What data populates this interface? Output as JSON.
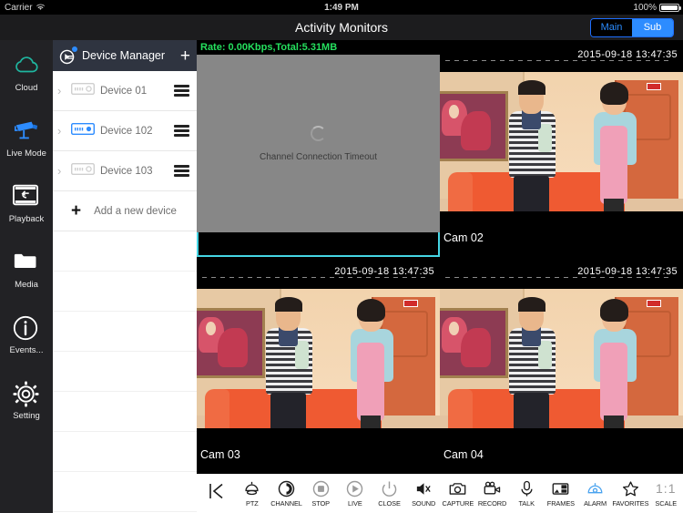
{
  "statusbar": {
    "carrier": "Carrier",
    "wifi_icon": "wifi-icon",
    "time": "1:49 PM",
    "battery": "100%"
  },
  "navbar": {
    "title": "Activity Monitors",
    "stream_toggle": {
      "options": [
        "Main",
        "Sub"
      ],
      "selected": "Sub"
    }
  },
  "rail": {
    "items": [
      {
        "label": "Cloud",
        "icon": "cloud-icon",
        "color": "#1fb6a0"
      },
      {
        "label": "Live Mode",
        "icon": "camera-icon",
        "color": "#2d8cff"
      },
      {
        "label": "Playback",
        "icon": "playback-icon",
        "color": "#ffffff"
      },
      {
        "label": "Media",
        "icon": "folder-icon",
        "color": "#ffffff"
      },
      {
        "label": "Events...",
        "icon": "info-icon",
        "color": "#ffffff"
      },
      {
        "label": "Setting",
        "icon": "gear-icon",
        "color": "#ffffff"
      }
    ]
  },
  "device_panel": {
    "header_title": "Device Manager",
    "header_icon": "dvr-badge-icon",
    "add_icon": "plus-icon",
    "devices": [
      {
        "name": "Device 01",
        "connected": false
      },
      {
        "name": "Device 102",
        "connected": true
      },
      {
        "name": "Device 103",
        "connected": false
      }
    ],
    "add_device_label": "Add a new device"
  },
  "grid": {
    "cells": [
      {
        "id": "cell-1",
        "selected": true,
        "state": "timeout",
        "rate_text": "Rate: 0.00Kbps,Total:5.31MB",
        "message": "Channel Connection Timeout",
        "timestamp": "",
        "label": ""
      },
      {
        "id": "cell-2",
        "selected": false,
        "state": "live",
        "rate_text": "",
        "message": "",
        "timestamp": "2015-09-18  13:47:35",
        "label": "Cam 02"
      },
      {
        "id": "cell-3",
        "selected": false,
        "state": "live",
        "rate_text": "",
        "message": "",
        "timestamp": "2015-09-18  13:47:35",
        "label": "Cam 03"
      },
      {
        "id": "cell-4",
        "selected": false,
        "state": "live",
        "rate_text": "",
        "message": "",
        "timestamp": "2015-09-18  13:47:35",
        "label": "Cam 04"
      }
    ],
    "selection_color": "#45d5e4",
    "rate_color": "#25e05e"
  },
  "toolbar": {
    "back_icon": "back-to-start-icon",
    "items": [
      {
        "label": "PTZ",
        "icon": "ptz-icon",
        "active": false
      },
      {
        "label": "CHANNEL",
        "icon": "channel-icon",
        "active": false
      },
      {
        "label": "STOP",
        "icon": "stop-icon",
        "active": false
      },
      {
        "label": "LIVE",
        "icon": "play-icon",
        "active": false
      },
      {
        "label": "CLOSE",
        "icon": "power-icon",
        "active": false
      },
      {
        "label": "SOUND",
        "icon": "speaker-icon",
        "active": false
      },
      {
        "label": "CAPTURE",
        "icon": "photo-camera-icon",
        "active": false
      },
      {
        "label": "RECORD",
        "icon": "video-camera-icon",
        "active": false
      },
      {
        "label": "TALK",
        "icon": "microphone-icon",
        "active": false
      },
      {
        "label": "FRAMES",
        "icon": "frames-icon",
        "active": false
      },
      {
        "label": "ALARM",
        "icon": "alarm-camera-icon",
        "active": true
      },
      {
        "label": "FAVORITES",
        "icon": "star-icon",
        "active": false
      },
      {
        "label": "SCALE",
        "icon": "one-to-one-icon",
        "active": false,
        "glyph": "1:1"
      }
    ],
    "accent": "#2d8cff"
  }
}
